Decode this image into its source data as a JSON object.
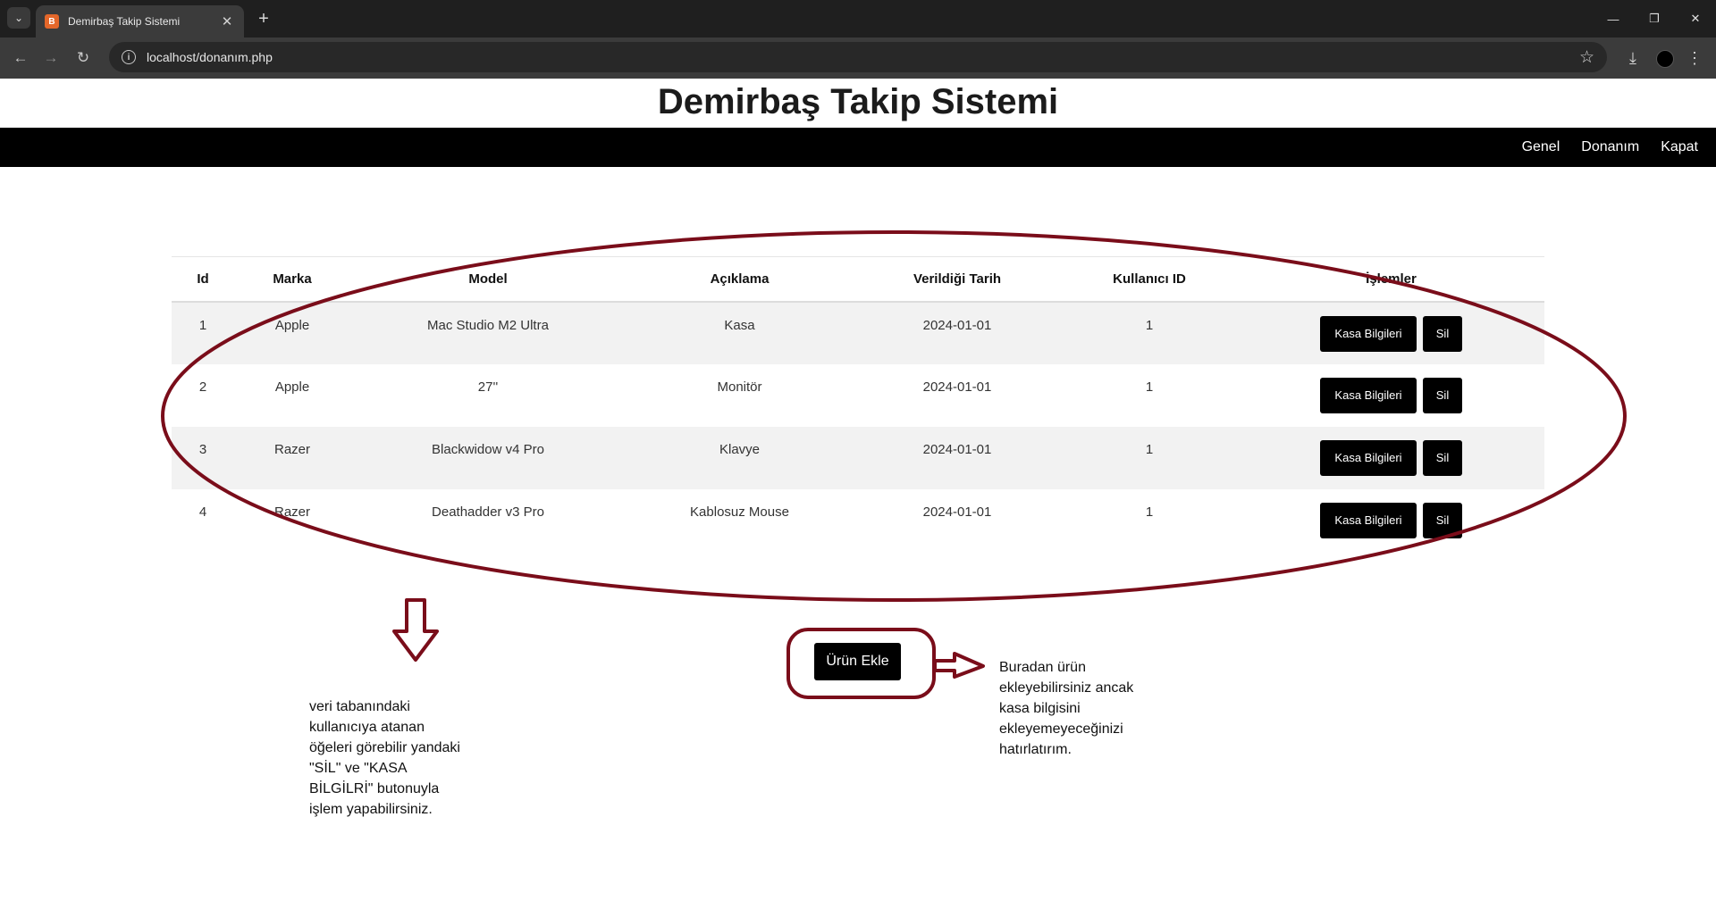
{
  "browser": {
    "tab_title": "Demirbaş Takip Sistemi",
    "url": "localhost/donanım.php"
  },
  "page": {
    "title": "Demirbaş Takip Sistemi",
    "nav": [
      "Genel",
      "Donanım",
      "Kapat"
    ]
  },
  "table": {
    "headers": [
      "Id",
      "Marka",
      "Model",
      "Açıklama",
      "Verildiği Tarih",
      "Kullanıcı ID",
      "İşlemler"
    ],
    "rows": [
      {
        "id": "1",
        "marka": "Apple",
        "model": "Mac Studio M2 Ultra",
        "aciklama": "Kasa",
        "tarih": "2024-01-01",
        "kullanici": "1"
      },
      {
        "id": "2",
        "marka": "Apple",
        "model": "27''",
        "aciklama": "Monitör",
        "tarih": "2024-01-01",
        "kullanici": "1"
      },
      {
        "id": "3",
        "marka": "Razer",
        "model": "Blackwidow v4 Pro",
        "aciklama": "Klavye",
        "tarih": "2024-01-01",
        "kullanici": "1"
      },
      {
        "id": "4",
        "marka": "Razer",
        "model": "Deathadder v3 Pro",
        "aciklama": "Kablosuz Mouse",
        "tarih": "2024-01-01",
        "kullanici": "1"
      }
    ],
    "kasa_button": "Kasa Bilgileri",
    "sil_button": "Sil"
  },
  "add_button": "Ürün Ekle",
  "notes": {
    "left": "veri tabanındaki kullanıcıya atanan öğeleri görebilir yandaki \"SİL\" ve \"KASA BİLGİLRİ\" butonuyla işlem yapabilirsiniz.",
    "right": "Buradan ürün ekleyebilirsiniz ancak kasa bilgisini ekleyemeyeceğinizi hatırlatırım."
  },
  "colors": {
    "annotation": "#7a0d1a",
    "navbar": "#000000",
    "row_stripe": "#f2f2f2"
  }
}
